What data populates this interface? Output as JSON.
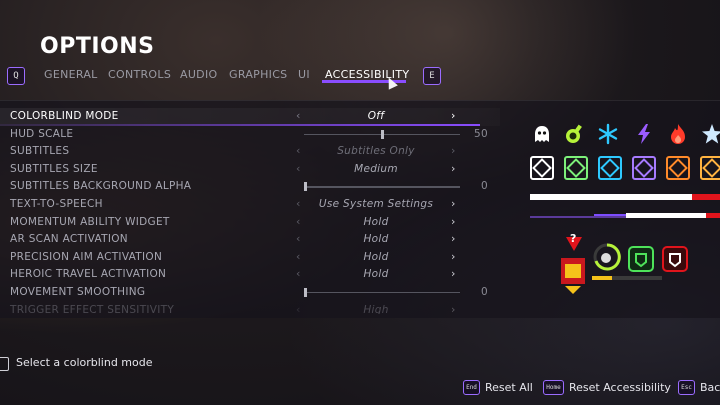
{
  "title": "OPTIONS",
  "tabs": {
    "prev_key": "Q",
    "next_key": "E",
    "items": [
      "GENERAL",
      "CONTROLS",
      "AUDIO",
      "GRAPHICS",
      "UI",
      "ACCESSIBILITY"
    ],
    "active": "ACCESSIBILITY"
  },
  "settings": [
    {
      "label": "COLORBLIND MODE",
      "value": "Off"
    },
    {
      "label": "HUD SCALE",
      "slider": 0.5,
      "number": "50"
    },
    {
      "label": "SUBTITLES",
      "value": "Subtitles Only"
    },
    {
      "label": "SUBTITLES SIZE",
      "value": "Medium"
    },
    {
      "label": "SUBTITLES BACKGROUND ALPHA",
      "slider": 0.0,
      "number": "0"
    },
    {
      "label": "TEXT-TO-SPEECH",
      "value": "Use System Settings"
    },
    {
      "label": "MOMENTUM ABILITY WIDGET",
      "value": "Hold"
    },
    {
      "label": "AR SCAN ACTIVATION",
      "value": "Hold"
    },
    {
      "label": "PRECISION AIM ACTIVATION",
      "value": "Hold"
    },
    {
      "label": "HEROIC TRAVEL ACTIVATION",
      "value": "Hold"
    },
    {
      "label": "MOVEMENT SMOOTHING",
      "slider": 0.0,
      "number": "0"
    },
    {
      "label": "TRIGGER EFFECT SENSITIVITY",
      "value": "High"
    }
  ],
  "hint": "Select a colorblind mode",
  "footer": {
    "reset_all_key": "End",
    "reset_all": "Reset All",
    "reset_accessibility_key": "Home",
    "reset_accessibility": "Reset Accessibility",
    "back_key": "Esc",
    "back": "Back"
  },
  "preview": {
    "question_mark": "?",
    "icons": [
      "ghost-icon",
      "flask-icon",
      "snowflake-icon",
      "lightning-icon",
      "flame-icon",
      "star-icon"
    ],
    "icon_colors": [
      "#ffffff",
      "#b6f23a",
      "#2ec9ff",
      "#9b5cff",
      "#ff3b2a",
      "#cfe9ff"
    ],
    "tile_colors": [
      "#ffffff",
      "#7df07a",
      "#2ec9ff",
      "#a77bff",
      "#ff8a2a",
      "#ffb340"
    ],
    "accent": "#8a4dff"
  }
}
